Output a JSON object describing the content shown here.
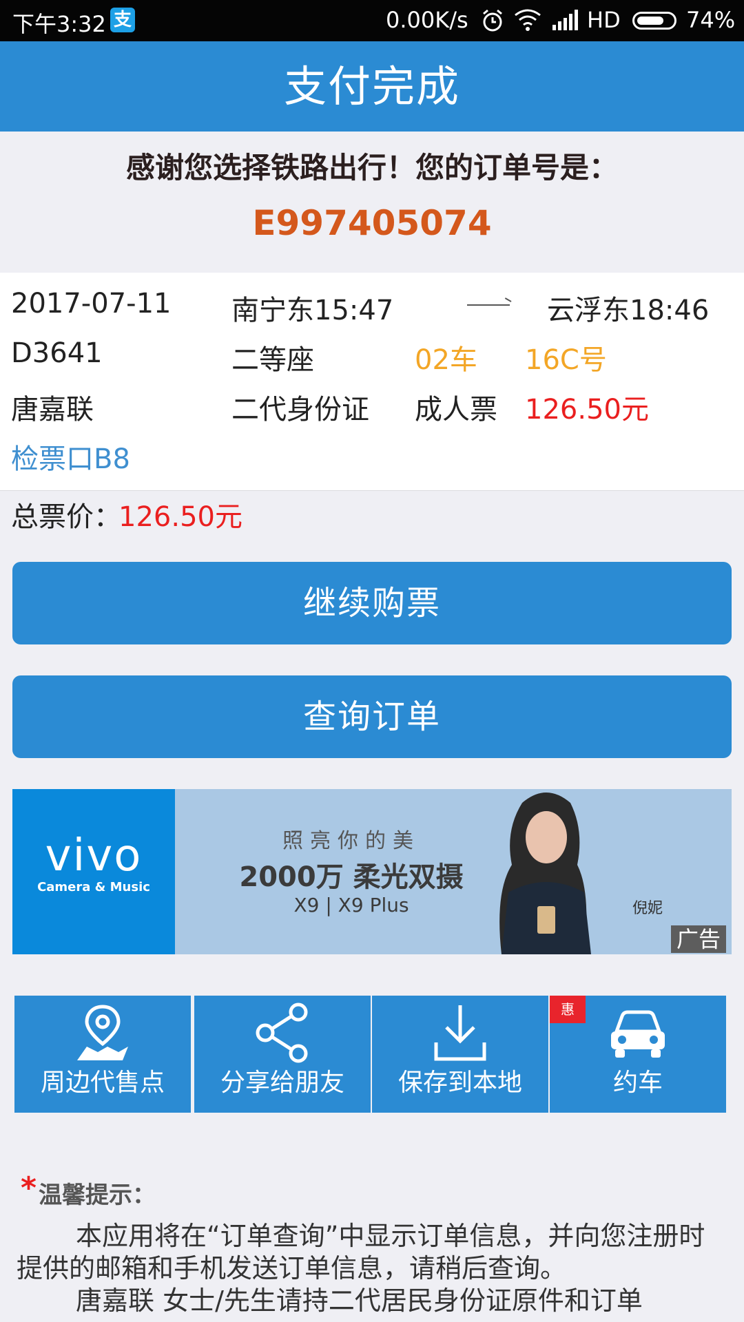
{
  "status_bar": {
    "time": "下午3:32",
    "speed": "0.00K/s",
    "network": "HD",
    "battery": "74%",
    "battery_level": 0.74,
    "icons": [
      "alipay-icon",
      "alarm-icon",
      "wifi-icon",
      "signal-icon",
      "battery-icon"
    ]
  },
  "header": {
    "title": "支付完成"
  },
  "confirmation": {
    "message": "感谢您选择铁路出行！您的订单号是：",
    "order_number": "E997405074"
  },
  "ticket": {
    "date": "2017-07-11",
    "departure": "南宁东15:47",
    "arrival": "云浮东18:46",
    "train_no": "D3641",
    "seat_class": "二等座",
    "car": "02车",
    "seat": "16C号",
    "passenger": "唐嘉联",
    "id_type": "二代身份证",
    "ticket_type": "成人票",
    "price": "126.50元",
    "gate": "检票口B8"
  },
  "total": {
    "label": "总票价：",
    "value": "126.50元"
  },
  "buttons": {
    "continue": "继续购票",
    "query": "查询订单"
  },
  "ad": {
    "brand": "vivo",
    "brand_sub": "Camera & Music",
    "line1": "照亮你的美",
    "line2": "2000万 柔光双摄",
    "line3": "X9 | X9 Plus",
    "signature": "倪妮",
    "tag": "广告"
  },
  "actions": [
    {
      "label": "周边代售点",
      "icon": "location-map-icon"
    },
    {
      "label": "分享给朋友",
      "icon": "share-icon"
    },
    {
      "label": "保存到本地",
      "icon": "download-icon"
    },
    {
      "label": "约车",
      "icon": "car-icon",
      "badge": "惠"
    }
  ],
  "tips": {
    "star": "*",
    "title": "温馨提示：",
    "para1": "本应用将在“订单查询”中显示订单信息，并向您注册时提供的邮箱和手机发送订单信息，请稍后查询。",
    "para2": "唐嘉联  女士/先生请持二代居民身份证原件和订单"
  },
  "colors": {
    "primary": "#2b8bd3",
    "order_number": "#d4581c",
    "price": "#ea1f1f",
    "seat_info": "#f3a626",
    "gate": "#3f8fd0",
    "badge": "#e8242c"
  }
}
